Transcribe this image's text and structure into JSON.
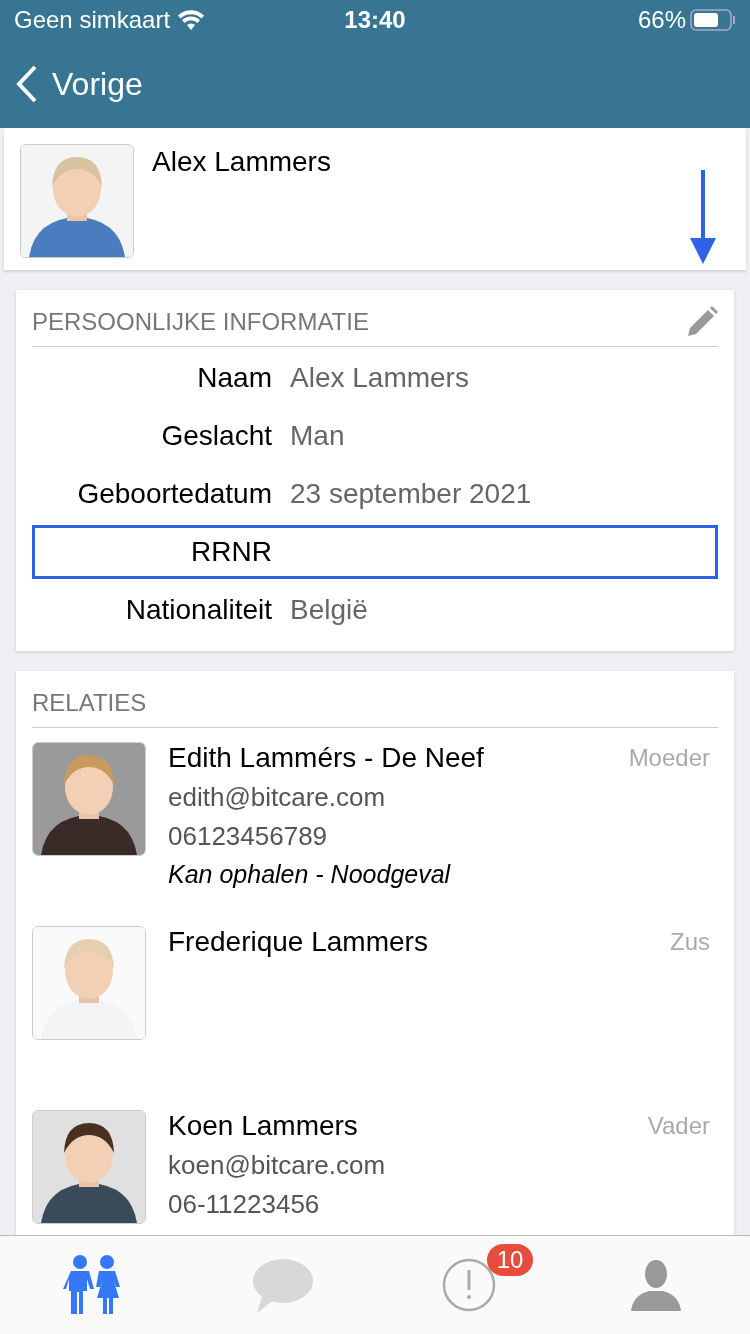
{
  "status_bar": {
    "carrier": "Geen simkaart",
    "time": "13:40",
    "battery": "66%"
  },
  "nav": {
    "back": "Vorige"
  },
  "profile": {
    "name": "Alex Lammers"
  },
  "personal_info": {
    "title": "PERSOONLIJKE INFORMATIE",
    "rows": [
      {
        "label": "Naam",
        "value": "Alex Lammers",
        "highlighted": false
      },
      {
        "label": "Geslacht",
        "value": "Man",
        "highlighted": false
      },
      {
        "label": "Geboortedatum",
        "value": "23 september 2021",
        "highlighted": false
      },
      {
        "label": "RRNR",
        "highlighted": true
      },
      {
        "label": "Nationaliteit",
        "value": "België",
        "highlighted": false
      }
    ]
  },
  "relations": {
    "title": "RELATIES",
    "items": [
      {
        "name": "Edith Lammérs - De Neef",
        "relation": "Moeder",
        "email": "edith@bitcare.com",
        "phone": "06123456789",
        "note": "Kan ophalen - Noodgeval"
      },
      {
        "name": "Frederique Lammers",
        "relation": "Zus"
      },
      {
        "name": "Koen Lammers",
        "relation": "Vader",
        "email": "koen@bitcare.com",
        "phone": "06-11223456"
      }
    ]
  },
  "tab_bar": {
    "tabs": [
      {
        "kind": "children",
        "selected": true
      },
      {
        "kind": "messages",
        "selected": false
      },
      {
        "kind": "alerts",
        "selected": false,
        "badge": "10"
      },
      {
        "kind": "profile",
        "selected": false
      }
    ]
  }
}
